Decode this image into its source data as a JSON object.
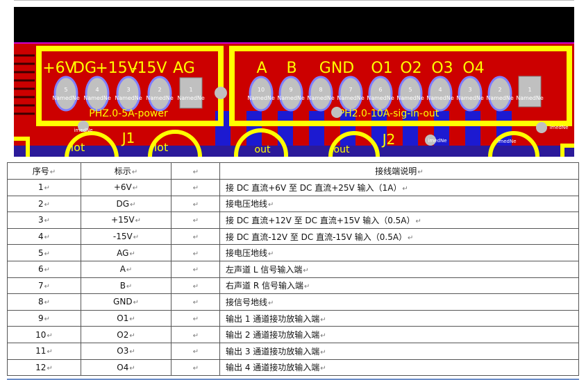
{
  "pcb": {
    "connector_left_labels": [
      "+6V",
      "DG",
      "+15V",
      "-15V",
      "AG"
    ],
    "connector_right_labels": [
      "A",
      "B",
      "GND",
      "O1",
      "O2",
      "O3",
      "O4"
    ],
    "pins_left": [
      "5",
      "4",
      "3",
      "2",
      "1"
    ],
    "pins_right": [
      "10",
      "9",
      "8",
      "7",
      "6",
      "5",
      "4",
      "3",
      "2",
      "1"
    ],
    "net_label": "NamedNe",
    "net_label_small": "imedNe",
    "footprint_left": "PHZ.0-5A-power",
    "footprint_right": "PH2.0-10A-sig-in-out",
    "designator_left": "J1",
    "designator_right": "J2",
    "cap_label": "lot",
    "out_label": "out",
    "colors": {
      "board": "#cc0000",
      "bottom": "#1c1ad1",
      "silk": "#ffff00",
      "pad": "#c0c0c0",
      "bg": "#000000",
      "magenta": "#d000d0"
    }
  },
  "table": {
    "headers": {
      "index": "序号",
      "label": "标示",
      "blank": "",
      "desc": "接线端说明"
    },
    "rows": [
      {
        "index": "1",
        "label": "+6V",
        "desc": "接 DC 直流+6V 至 DC 直流+25V 输入（1A）"
      },
      {
        "index": "2",
        "label": "DG",
        "desc": "接电压地线"
      },
      {
        "index": "3",
        "label": "+15V",
        "desc": "接 DC 直流+12V 至 DC 直流+15V 输入（0.5A）"
      },
      {
        "index": "4",
        "label": "-15V",
        "desc": "接 DC 直流-12V 至 DC 直流-15V 输入（0.5A）"
      },
      {
        "index": "5",
        "label": "AG",
        "desc": "接电压地线"
      },
      {
        "index": "6",
        "label": "A",
        "desc": "左声道 L 信号输入端"
      },
      {
        "index": "7",
        "label": "B",
        "desc": "右声道 R 信号输入端"
      },
      {
        "index": "8",
        "label": "GND",
        "desc": "接信号地线"
      },
      {
        "index": "9",
        "label": "O1",
        "desc": "输出 1 通道接功放输入端"
      },
      {
        "index": "10",
        "label": "O2",
        "desc": "输出 2 通道接功放输入端"
      },
      {
        "index": "11",
        "label": "O3",
        "desc": "输出 3 通道接功放输入端"
      },
      {
        "index": "12",
        "label": "O4",
        "desc": "输出 4 通道接功放输入端"
      }
    ],
    "paragraph_mark": "↵"
  }
}
